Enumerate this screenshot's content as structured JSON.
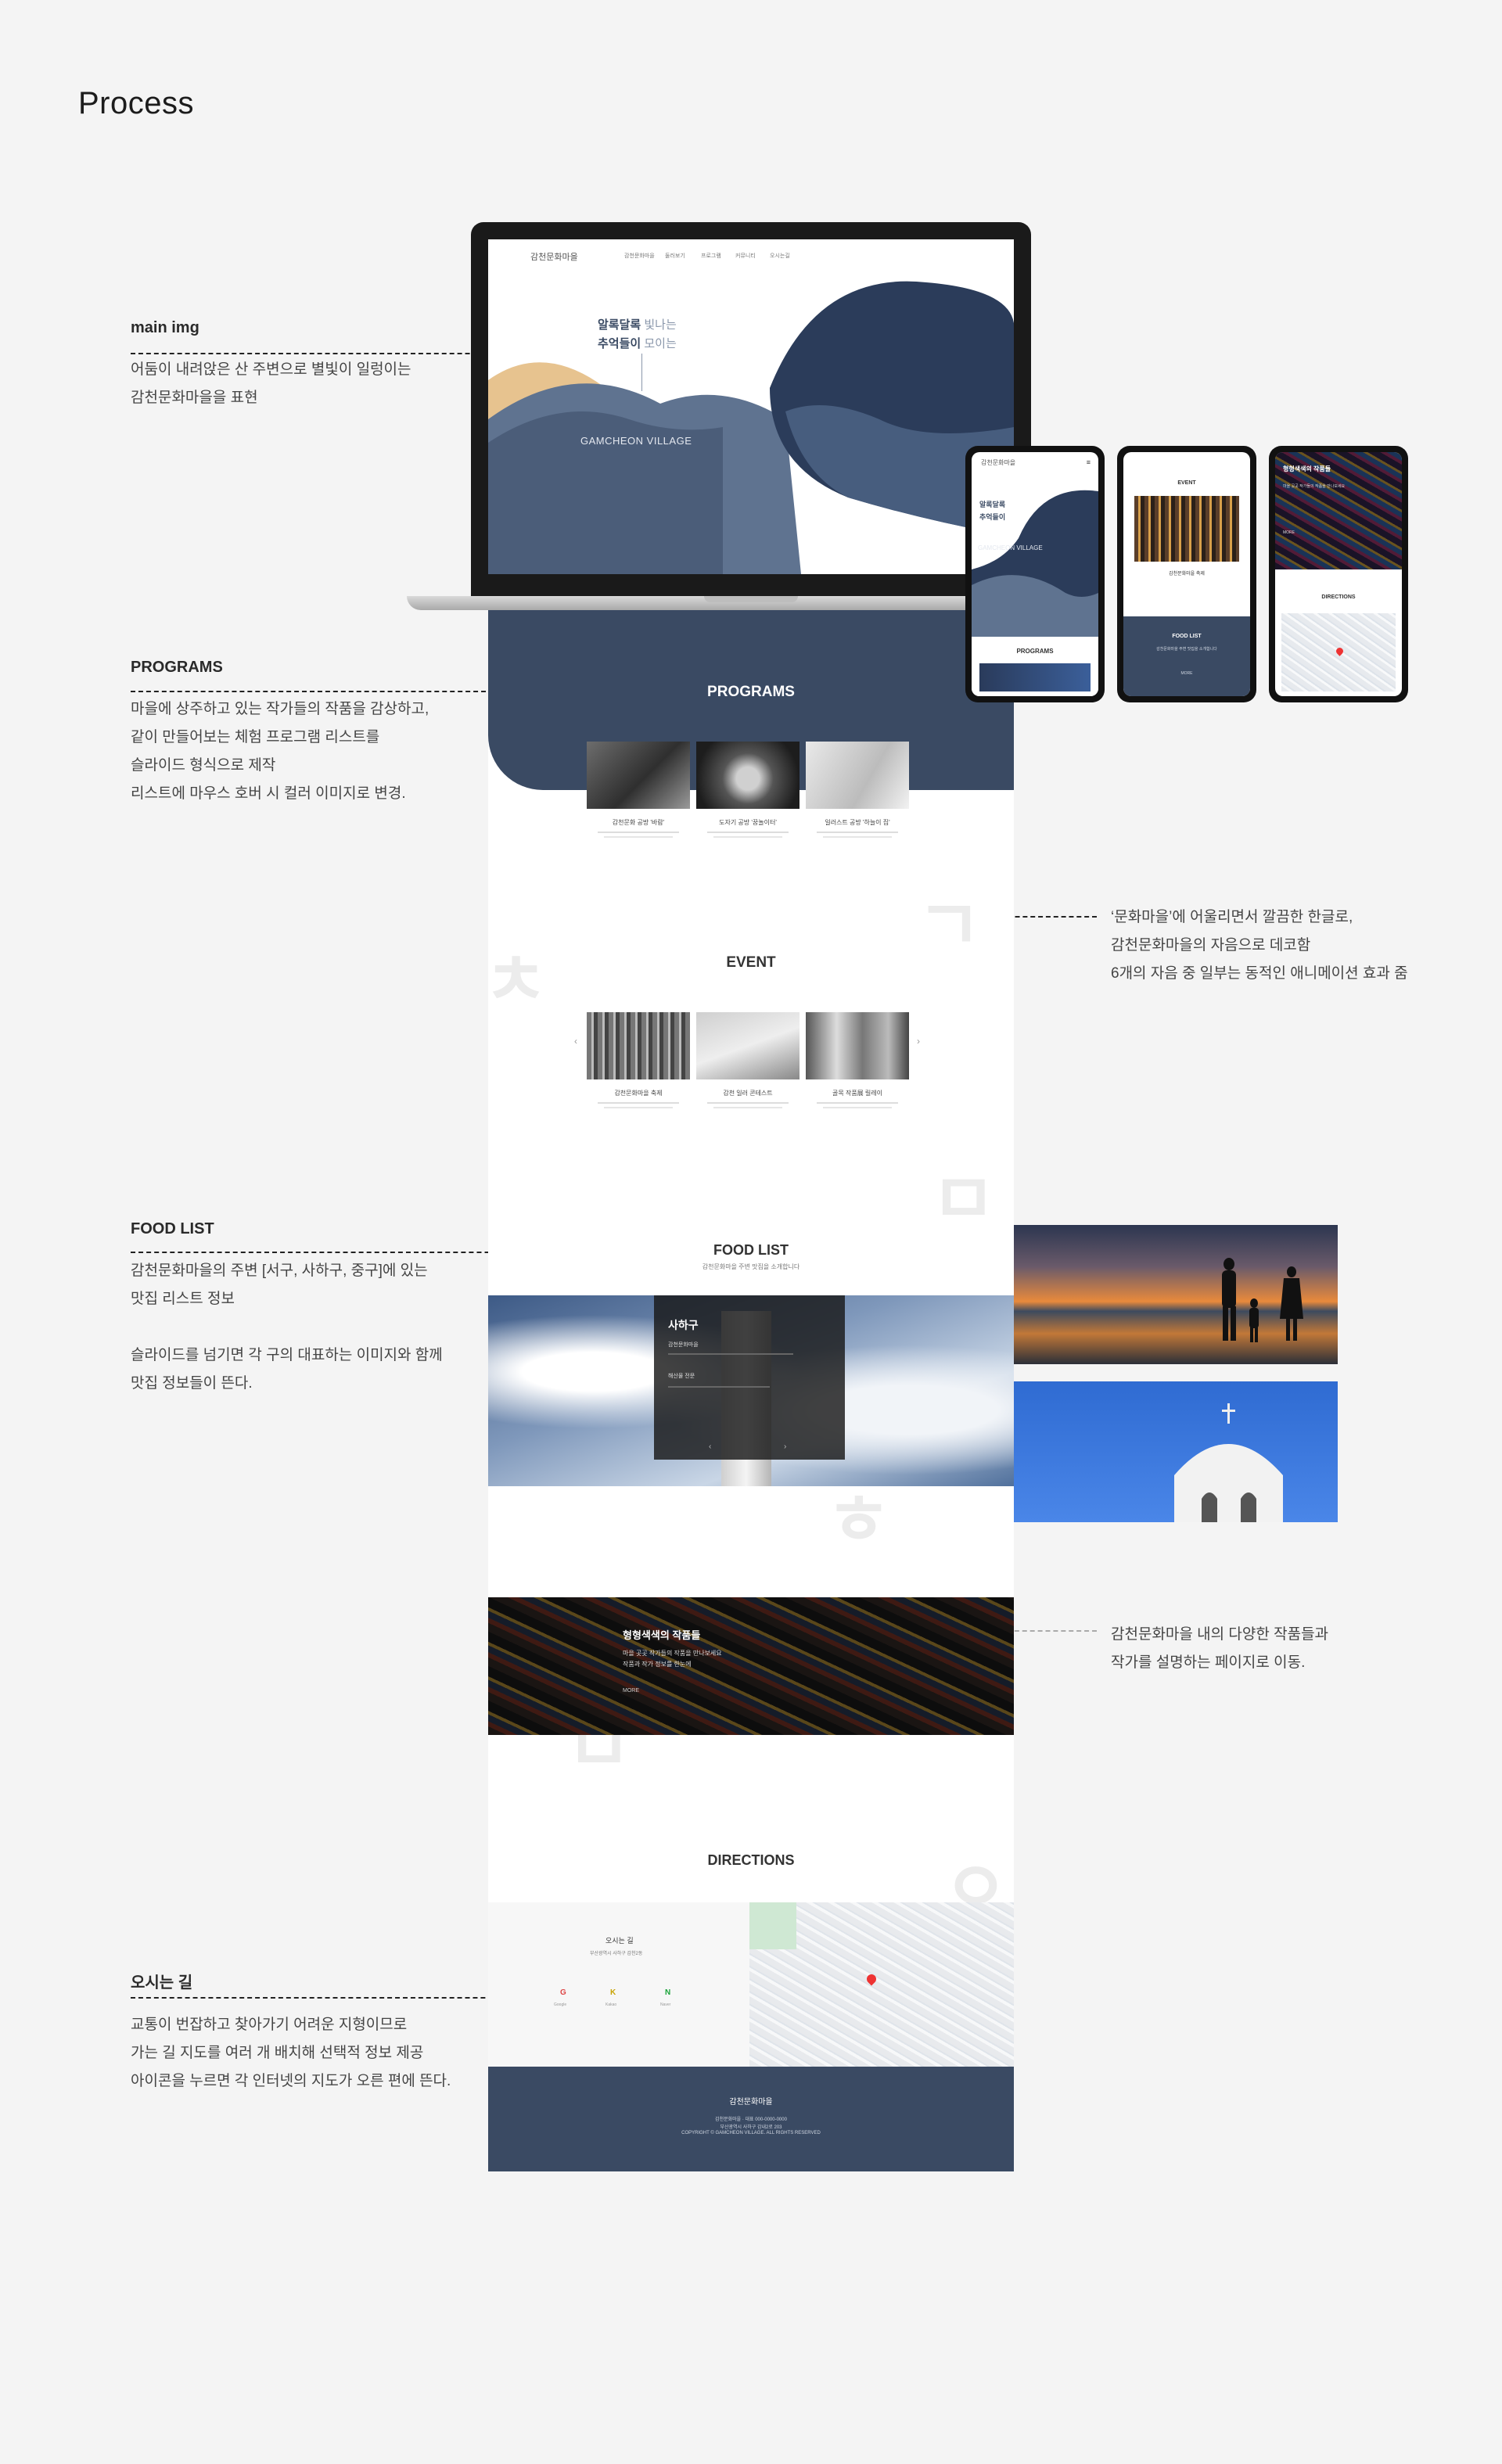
{
  "page": {
    "title": "Process"
  },
  "annotations": {
    "main_img": {
      "title": "main img",
      "desc": "어둠이 내려앉은 산 주변으로 별빛이 일렁이는\n감천문화마을을 표현"
    },
    "programs": {
      "title": "PROGRAMS",
      "desc": "마을에 상주하고 있는 작가들의 작품을 감상하고,\n같이 만들어보는 체험 프로그램 리스트를\n슬라이드 형식으로 제작\n리스트에 마우스 호버 시 컬러 이미지로 변경."
    },
    "hangul": {
      "desc": "‘문화마을’에 어울리면서 깔끔한 한글로,\n감천문화마을의 자음으로 데코함\n6개의 자음 중 일부는 동적인 애니메이션 효과 줌"
    },
    "food_list": {
      "title": "FOOD LIST",
      "desc": "감천문화마을의 주변 [서구, 사하구, 중구]에 있는\n맛집 리스트 정보\n\n슬라이드를 넘기면 각 구의 대표하는 이미지와 함께\n맛집 정보들이 뜬다."
    },
    "works": {
      "desc": "감천문화마을 내의 다양한 작품들과\n작가를 설명하는 페이지로 이동."
    },
    "directions": {
      "title": "오시는 길",
      "desc": "교통이 번잡하고 찾아가기 어려운 지형이므로\n가는 길 지도를 여러 개 배치해 선택적 정보 제공\n아이콘을 누르면 각 인터넷의 지도가 오른 편에 뜬다."
    }
  },
  "site": {
    "logo": "감천문화마을",
    "nav": [
      "감천문화마을",
      "둘러보기",
      "프로그램",
      "커뮤니티",
      "오시는길"
    ],
    "hero_line1a": "알록달록",
    "hero_line1b": "빛나는",
    "hero_line2a": "추억들이",
    "hero_line2b": "모이는",
    "hero_brand": "GAMCHEON VILLAGE",
    "programs_heading": "PROGRAMS",
    "programs": [
      {
        "title": "감천문화 공방 '바람'"
      },
      {
        "title": "도자기 공방 '꿈놀이터'"
      },
      {
        "title": "일러스트 공방 '하늘이 집'"
      }
    ],
    "event_heading": "EVENT",
    "events": [
      {
        "title": "감천문화마을 축제"
      },
      {
        "title": "감천 일러 콘테스트"
      },
      {
        "title": "골목 작품展 릴레이"
      }
    ],
    "event_prev": "‹",
    "event_next": "›",
    "food_heading": "FOOD LIST",
    "food_sub": "감천문화마을 주변 맛집을 소개합니다",
    "food_card_title": "사하구",
    "food_card_sub1": "감천문화마을",
    "food_card_sub2": "해산물 전문",
    "works_heading": "형형색색의 작품들",
    "works_text1": "마을 곳곳 작가들의 작품을 만나보세요",
    "works_text2": "작품과 작가 정보를 한눈에",
    "works_more": "MORE",
    "directions_heading": "DIRECTIONS",
    "directions_title": "오시는 길",
    "directions_addr": "부산광역시 사하구 감천2동",
    "map_icons": [
      "G",
      "K",
      "N"
    ],
    "map_icon_labels": [
      "Google",
      "Kakao",
      "Naver"
    ],
    "footer_logo": "감천문화마을",
    "footer_lines": [
      "감천문화마을 · 대표 000-0000-0000",
      "부산광역시 사하구 감내2로 203",
      "COPYRIGHT © GAMCHEON VILLAGE. ALL RIGHTS RESERVED"
    ]
  },
  "phones": {
    "p1": {
      "logo": "감천문화마을",
      "hero1": "알록달록",
      "hero2": "추억들이",
      "brand": "GAMCHEON VILLAGE",
      "section": "PROGRAMS"
    },
    "p2": {
      "heading": "EVENT",
      "title": "감천문화마을 축제",
      "food": "FOOD LIST",
      "food_sub": "감천문화마을 주변 맛집을 소개합니다",
      "more": "MORE"
    },
    "p3": {
      "heading": "형형색색의 작품들",
      "text": "마을 곳곳 작가들의 작품을 만나보세요",
      "more": "MORE",
      "dir": "DIRECTIONS"
    }
  },
  "colors": {
    "navy": "#3a4a63",
    "gold": "#e7c38f",
    "slate": "#5f7390"
  }
}
